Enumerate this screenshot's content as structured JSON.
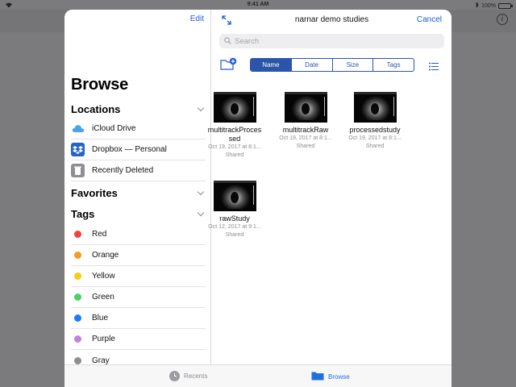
{
  "status_bar": {
    "time": "9:41 AM",
    "battery": "100%"
  },
  "sidebar": {
    "edit_label": "Edit",
    "title": "Browse",
    "locations": {
      "title": "Locations",
      "items": [
        {
          "label": "iCloud Drive",
          "icon": "icloud-icon"
        },
        {
          "label": "Dropbox — Personal",
          "icon": "dropbox-icon"
        },
        {
          "label": "Recently Deleted",
          "icon": "trash-icon"
        }
      ]
    },
    "favorites": {
      "title": "Favorites"
    },
    "tags": {
      "title": "Tags",
      "items": [
        {
          "label": "Red",
          "color": "#f0443b"
        },
        {
          "label": "Orange",
          "color": "#f59a23"
        },
        {
          "label": "Yellow",
          "color": "#f7cc16"
        },
        {
          "label": "Green",
          "color": "#4cd262"
        },
        {
          "label": "Blue",
          "color": "#1f7cf5"
        },
        {
          "label": "Purple",
          "color": "#c47fe0"
        },
        {
          "label": "Gray",
          "color": "#8f8f93"
        }
      ]
    }
  },
  "main": {
    "title": "narnar demo studies",
    "cancel_label": "Cancel",
    "search_placeholder": "Search",
    "sort": {
      "options": [
        "Name",
        "Date",
        "Size",
        "Tags"
      ],
      "selected": "Name"
    },
    "files": [
      {
        "name_line1": "multitrackProces",
        "name_line2": "sed",
        "date": "Oct 19, 2017 at 8:1...",
        "status": "Shared"
      },
      {
        "name_line1": "multitrackRaw",
        "name_line2": "",
        "date": "Oct 19, 2017 at 8:1...",
        "status": "Shared"
      },
      {
        "name_line1": "processedstudy",
        "name_line2": "",
        "date": "Oct 19, 2017 at 8:1...",
        "status": "Shared"
      },
      {
        "name_line1": "rawStudy",
        "name_line2": "",
        "date": "Oct 12, 2017 at 9:1...",
        "status": "Shared"
      }
    ]
  },
  "tabbar": {
    "recents_label": "Recents",
    "browse_label": "Browse",
    "active_color": "#1f6fe0"
  },
  "accent_color": "#1c5bd6"
}
